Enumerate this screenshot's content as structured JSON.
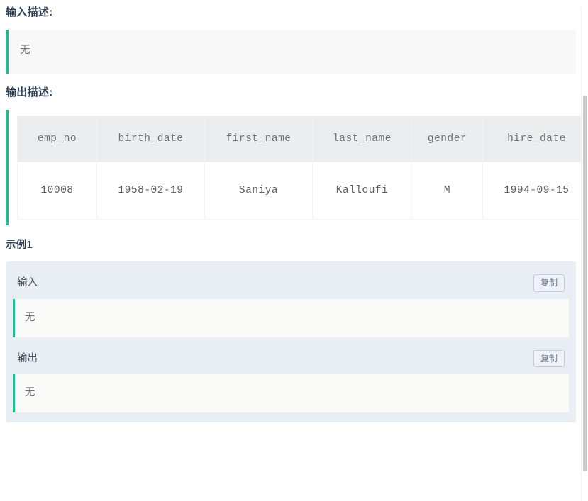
{
  "sections": {
    "input_description": {
      "heading": "输入描述:",
      "content": "无"
    },
    "output_description": {
      "heading": "输出描述:",
      "table": {
        "columns": [
          "emp_no",
          "birth_date",
          "first_name",
          "last_name",
          "gender",
          "hire_date"
        ],
        "rows": [
          [
            "10008",
            "1958-02-19",
            "Saniya",
            "Kalloufi",
            "M",
            "1994-09-15"
          ]
        ]
      }
    },
    "example": {
      "heading": "示例1",
      "input": {
        "label": "输入",
        "copy_label": "复制",
        "content": "无"
      },
      "output": {
        "label": "输出",
        "copy_label": "复制",
        "content": "无"
      }
    }
  },
  "colors": {
    "accent_green": "#2bb692",
    "heading_text": "#2c3e50",
    "panel_background": "#e9edf4",
    "code_background": "#fafaf9",
    "table_header_background": "#ecedef"
  }
}
